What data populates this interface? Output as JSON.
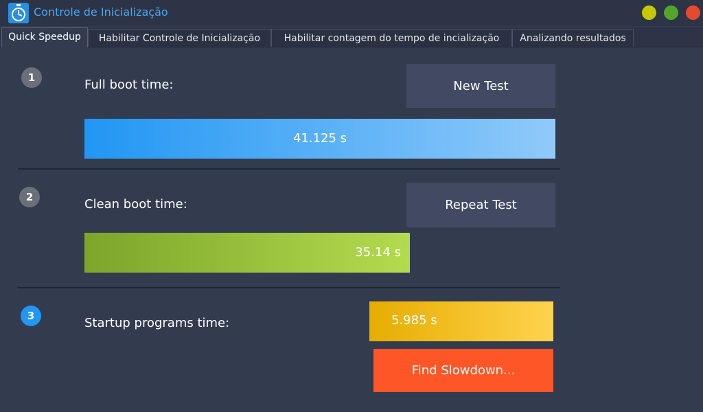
{
  "window": {
    "title": "Controle de Inicialização",
    "controls": [
      "minimize",
      "maximize",
      "close"
    ]
  },
  "tabs": [
    {
      "label": "Quick Speedup",
      "active": true
    },
    {
      "label": "Habilitar Controle de Inicialização",
      "active": false
    },
    {
      "label": "Habilitar contagem do tempo de incialização",
      "active": false
    },
    {
      "label": "Analizando resultados",
      "active": false
    }
  ],
  "steps": {
    "full_boot": {
      "number": "1",
      "label": "Full boot time:",
      "button_label": "New Test",
      "value_text": "41.125 s",
      "value": 41.125,
      "bar_colors": [
        "#2196f3",
        "#90caf9"
      ]
    },
    "clean_boot": {
      "number": "2",
      "label": "Clean boot time:",
      "button_label": "Repeat Test",
      "value_text": "35.14 s",
      "value": 35.14,
      "bar_colors": [
        "#7ca52a",
        "#b4db4e"
      ]
    },
    "startup_programs": {
      "number": "3",
      "label": "Startup programs time:",
      "value_text": "5.985 s",
      "value": 5.985,
      "bar_colors": [
        "#e6ad00",
        "#ffd34f"
      ],
      "button_label": "Find Slowdown..."
    }
  },
  "colors": {
    "background": "#333b4f",
    "titlebar": "#2c3446",
    "accent_blue": "#2196f3",
    "find_button": "#ff5627"
  }
}
